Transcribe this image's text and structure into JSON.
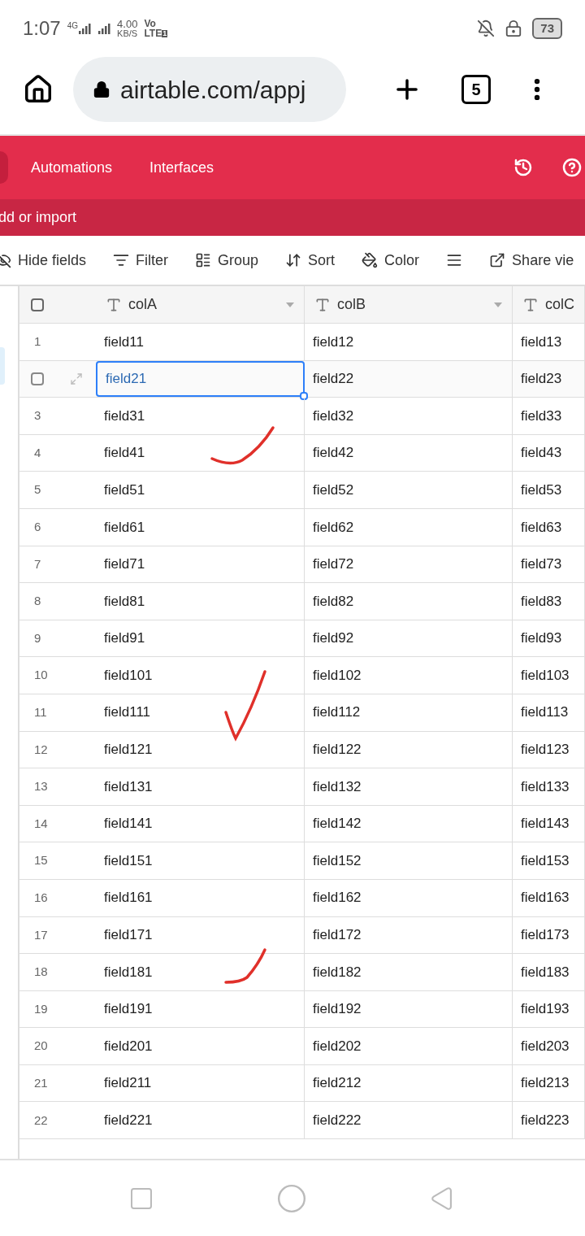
{
  "status_bar": {
    "time": "1:07",
    "network": "4G",
    "speed": "4.00",
    "speed_unit": "KB/S",
    "volte_top": "Vo",
    "volte_bottom": "LTE",
    "sim": "1",
    "battery": "73"
  },
  "browser": {
    "url": "airtable.com/appj",
    "tab_count": "5"
  },
  "app_bar": {
    "nav": [
      "Automations",
      "Interfaces"
    ]
  },
  "sub_bar": {
    "text": "dd or import"
  },
  "toolbar": [
    {
      "kind": "hide",
      "label": "Hide fields"
    },
    {
      "kind": "filter",
      "label": "Filter"
    },
    {
      "kind": "group",
      "label": "Group"
    },
    {
      "kind": "sort",
      "label": "Sort"
    },
    {
      "kind": "color",
      "label": "Color"
    },
    {
      "kind": "height"
    },
    {
      "kind": "share",
      "label": "Share vie"
    }
  ],
  "table": {
    "select_all": {
      "checked": false
    },
    "columns": [
      "colA",
      "colB",
      "colC"
    ],
    "rows": [
      {
        "number": "1",
        "cells": [
          "field11",
          "field12",
          "field13"
        ],
        "selected": false
      },
      {
        "cells": [
          "field21",
          "field22",
          "field23"
        ],
        "selected": true
      },
      {
        "number": "3",
        "cells": [
          "field31",
          "field32",
          "field33"
        ],
        "selected": false
      },
      {
        "number": "4",
        "cells": [
          "field41",
          "field42",
          "field43"
        ],
        "selected": false
      },
      {
        "number": "5",
        "cells": [
          "field51",
          "field52",
          "field53"
        ],
        "selected": false
      },
      {
        "number": "6",
        "cells": [
          "field61",
          "field62",
          "field63"
        ],
        "selected": false
      },
      {
        "number": "7",
        "cells": [
          "field71",
          "field72",
          "field73"
        ],
        "selected": false
      },
      {
        "number": "8",
        "cells": [
          "field81",
          "field82",
          "field83"
        ],
        "selected": false
      },
      {
        "number": "9",
        "cells": [
          "field91",
          "field92",
          "field93"
        ],
        "selected": false
      },
      {
        "number": "10",
        "cells": [
          "field101",
          "field102",
          "field103"
        ],
        "selected": false
      },
      {
        "number": "11",
        "cells": [
          "field111",
          "field112",
          "field113"
        ],
        "selected": false
      },
      {
        "number": "12",
        "cells": [
          "field121",
          "field122",
          "field123"
        ],
        "selected": false
      },
      {
        "number": "13",
        "cells": [
          "field131",
          "field132",
          "field133"
        ],
        "selected": false
      },
      {
        "number": "14",
        "cells": [
          "field141",
          "field142",
          "field143"
        ],
        "selected": false
      },
      {
        "number": "15",
        "cells": [
          "field151",
          "field152",
          "field153"
        ],
        "selected": false
      },
      {
        "number": "16",
        "cells": [
          "field161",
          "field162",
          "field163"
        ],
        "selected": false
      },
      {
        "number": "17",
        "cells": [
          "field171",
          "field172",
          "field173"
        ],
        "selected": false
      },
      {
        "number": "18",
        "cells": [
          "field181",
          "field182",
          "field183"
        ],
        "selected": false
      },
      {
        "number": "19",
        "cells": [
          "field191",
          "field192",
          "field193"
        ],
        "selected": false
      },
      {
        "number": "20",
        "cells": [
          "field201",
          "field202",
          "field203"
        ],
        "selected": false
      },
      {
        "number": "21",
        "cells": [
          "field211",
          "field212",
          "field213"
        ],
        "selected": false
      },
      {
        "number": "22",
        "cells": [
          "field221",
          "field222",
          "field223"
        ],
        "selected": false
      }
    ]
  }
}
